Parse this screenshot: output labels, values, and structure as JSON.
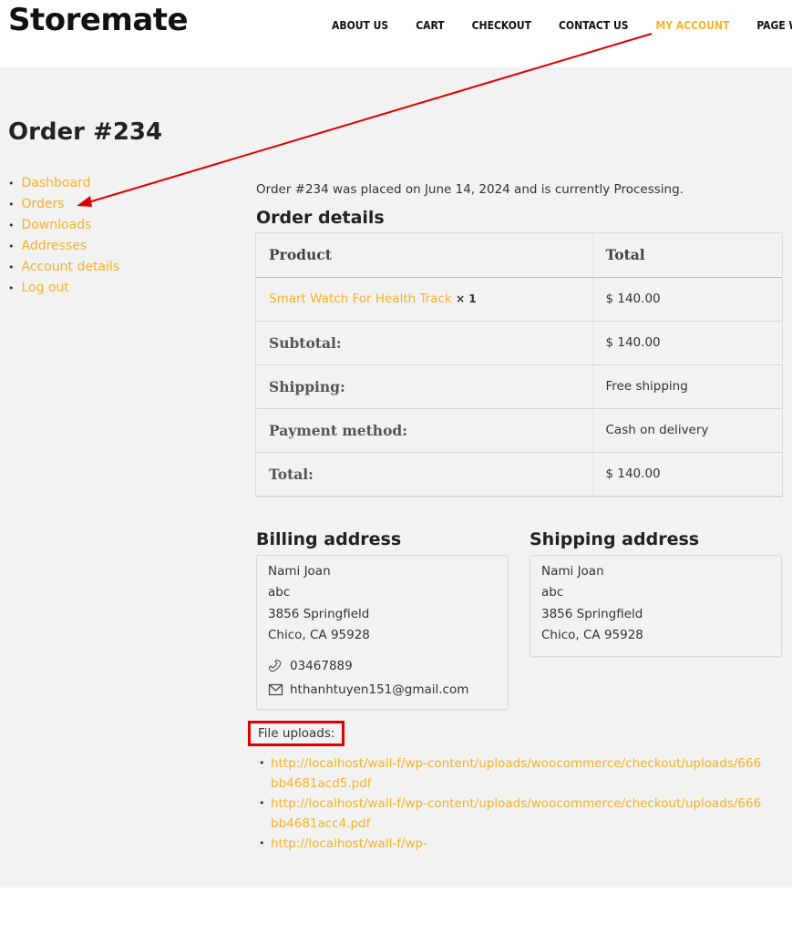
{
  "site": {
    "logo": "Storemate"
  },
  "nav": {
    "items": [
      {
        "label": "ABOUT US"
      },
      {
        "label": "CART"
      },
      {
        "label": "CHECKOUT"
      },
      {
        "label": "CONTACT US"
      },
      {
        "label": "MY ACCOUNT"
      },
      {
        "label": "PAGE WITH"
      }
    ],
    "active_color": "#f5b325"
  },
  "page": {
    "title": "Order #234"
  },
  "account_nav": [
    {
      "label": "Dashboard"
    },
    {
      "label": "Orders"
    },
    {
      "label": "Downloads"
    },
    {
      "label": "Addresses"
    },
    {
      "label": "Account details"
    },
    {
      "label": "Log out"
    }
  ],
  "order": {
    "intro": "Order #234 was placed on June 14, 2024 and is currently Processing.",
    "details_heading": "Order details",
    "table": {
      "col_product": "Product",
      "col_total": "Total",
      "item_name": "Smart Watch For Health Track",
      "item_qty": "× 1",
      "item_total": "$ 140.00",
      "subtotal_label": "Subtotal:",
      "subtotal_value": "$ 140.00",
      "shipping_label": "Shipping:",
      "shipping_value": "Free shipping",
      "payment_label": "Payment method:",
      "payment_value": "Cash on delivery",
      "total_label": "Total:",
      "total_value": "$ 140.00"
    }
  },
  "billing": {
    "heading": "Billing address",
    "name": "Nami Joan",
    "line1": "abc",
    "line2": "3856 Springfield",
    "line3": "Chico, CA 95928",
    "phone": "03467889",
    "email": "hthanhtuyen151@gmail.com",
    "phone_icon": "phone-icon",
    "email_icon": "mail-icon"
  },
  "shipping": {
    "heading": "Shipping address",
    "name": "Nami Joan",
    "line1": "abc",
    "line2": "3856 Springfield",
    "line3": "Chico, CA 95928"
  },
  "uploads": {
    "label": "File uploads:",
    "files": [
      "http://localhost/wall-f/wp-content/uploads/woocommerce/checkout/uploads/666bb4681acd5.pdf",
      "http://localhost/wall-f/wp-content/uploads/woocommerce/checkout/uploads/666bb4681acc4.pdf",
      "http://localhost/wall-f/wp-"
    ]
  },
  "colors": {
    "accent": "#f5b325",
    "annotation": "#e00000",
    "background": "#f2f2f2"
  }
}
